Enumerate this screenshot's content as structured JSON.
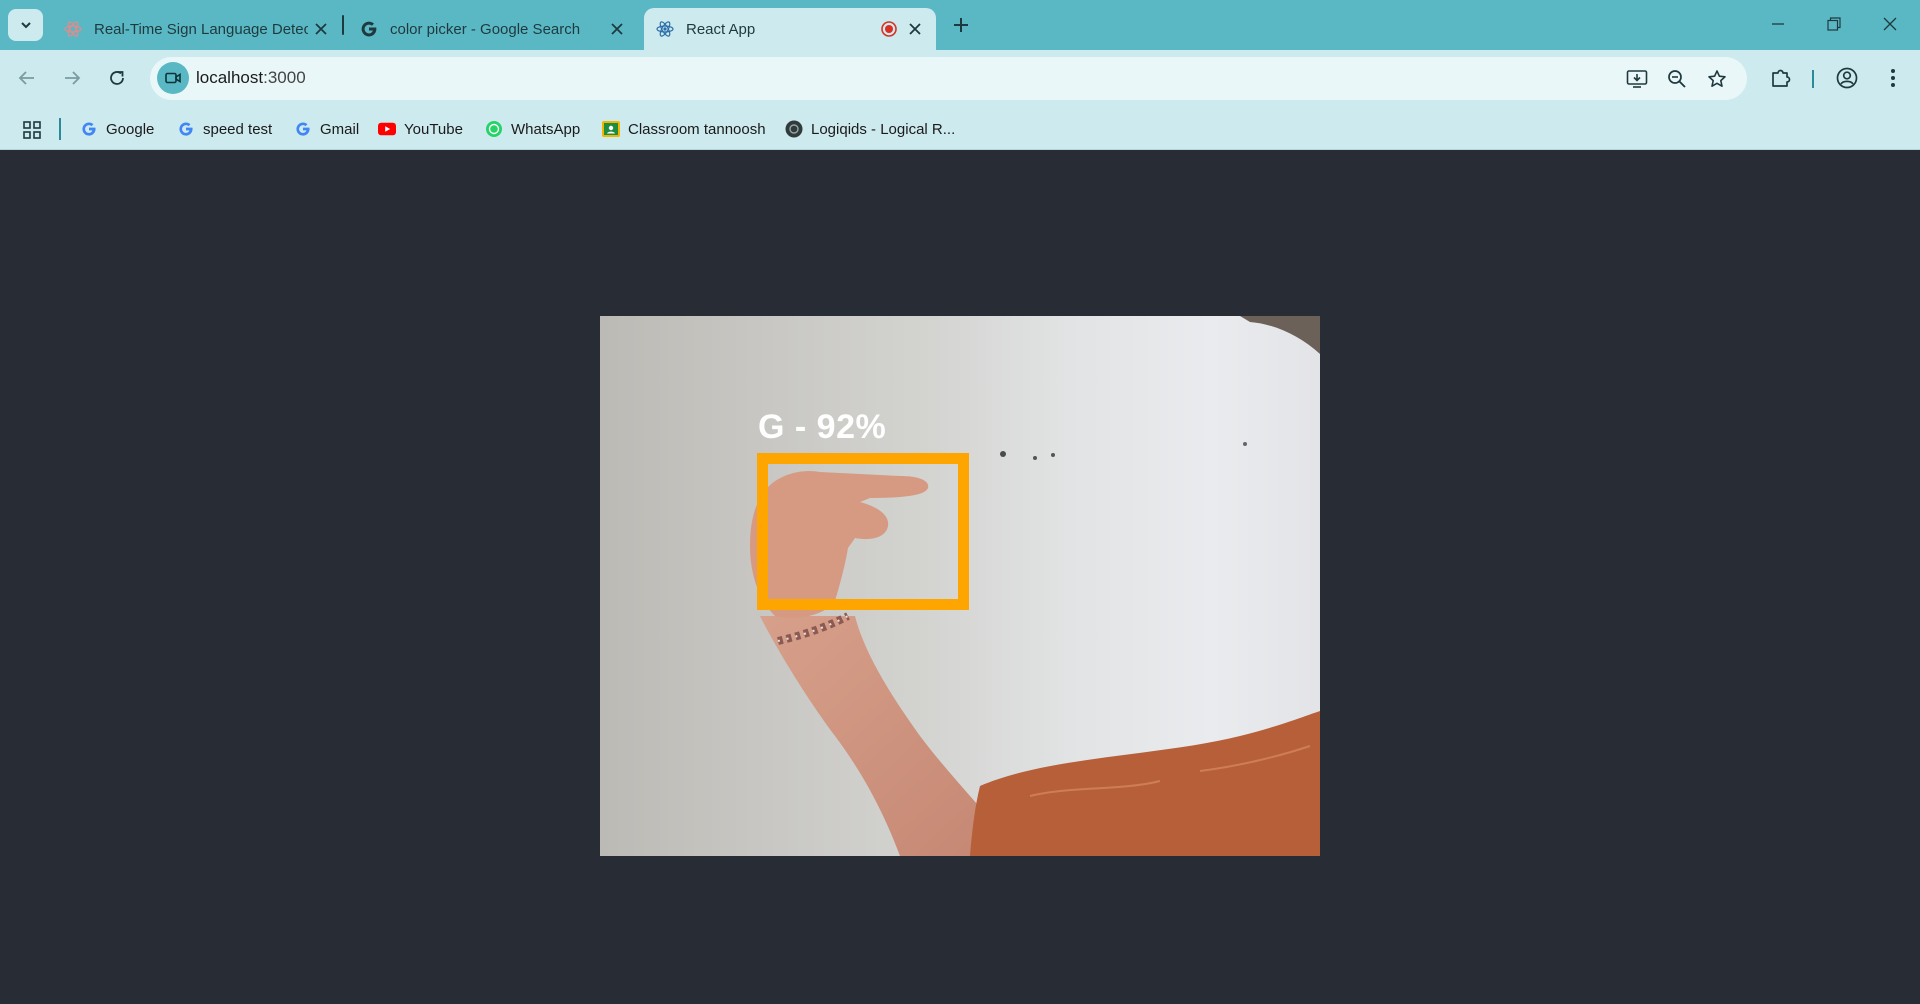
{
  "tabs": [
    {
      "title": "Real-Time Sign Language Detec",
      "icon": "react-icon",
      "active": false
    },
    {
      "title": "color picker - Google Search",
      "icon": "google-g-icon",
      "active": false
    },
    {
      "title": "React App",
      "icon": "react-icon",
      "active": true,
      "recording": true
    }
  ],
  "address_bar": {
    "host": "localhost",
    "port": ":3000"
  },
  "bookmarks": [
    {
      "label": "Google",
      "icon": "google-g-icon"
    },
    {
      "label": "speed test",
      "icon": "google-g-icon"
    },
    {
      "label": "Gmail",
      "icon": "google-g-icon"
    },
    {
      "label": "YouTube",
      "icon": "youtube-icon"
    },
    {
      "label": "WhatsApp",
      "icon": "whatsapp-icon"
    },
    {
      "label": "Classroom tannoosh",
      "icon": "classroom-icon"
    },
    {
      "label": "Logiqids - Logical R...",
      "icon": "logiqids-icon"
    }
  ],
  "detection": {
    "label": "G - 92%",
    "box_color": "#ffa500"
  },
  "colors": {
    "tab_strip": "#5ab8c4",
    "toolbar": "#cdeaee",
    "page_bg": "#282c34"
  }
}
